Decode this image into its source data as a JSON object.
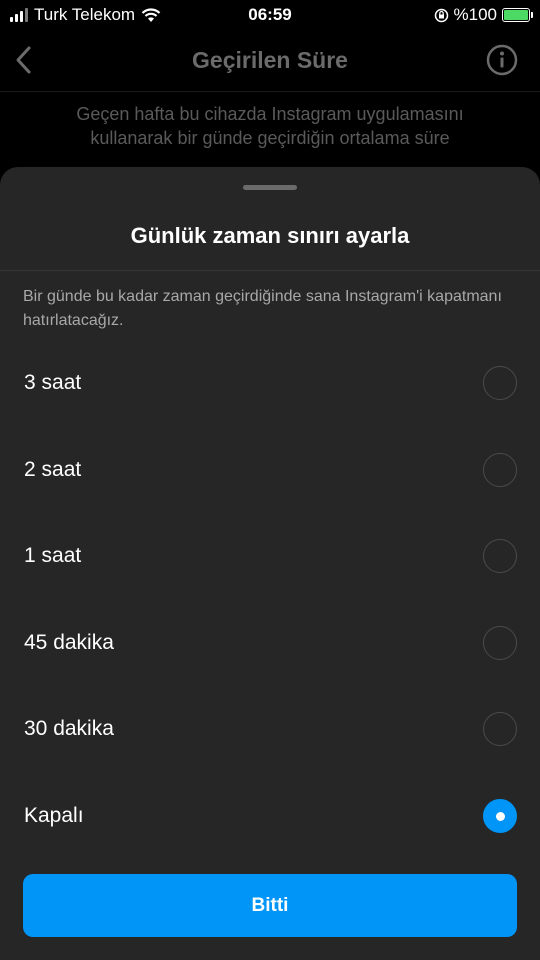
{
  "status_bar": {
    "carrier": "Turk Telekom",
    "time": "06:59",
    "battery_text": "%100"
  },
  "background_page": {
    "title": "Geçirilen Süre",
    "description": "Geçen hafta bu cihazda Instagram uygulamasını kullanarak bir günde geçirdiğin ortalama süre"
  },
  "sheet": {
    "title": "Günlük zaman sınırı ayarla",
    "note": "Bir günde bu kadar zaman geçirdiğinde sana Instagram'i kapatmanı hatırlatacağız.",
    "options": [
      {
        "label": "3 saat",
        "selected": false
      },
      {
        "label": "2 saat",
        "selected": false
      },
      {
        "label": "1 saat",
        "selected": false
      },
      {
        "label": "45 dakika",
        "selected": false
      },
      {
        "label": "30 dakika",
        "selected": false
      },
      {
        "label": "Kapalı",
        "selected": true
      }
    ],
    "done_label": "Bitti"
  },
  "colors": {
    "accent": "#0095f6",
    "sheet_bg": "#262626",
    "battery": "#4cd964"
  },
  "icons": [
    "signal-icon",
    "wifi-icon",
    "rotation-lock-icon",
    "battery-icon",
    "back-icon",
    "info-icon"
  ]
}
